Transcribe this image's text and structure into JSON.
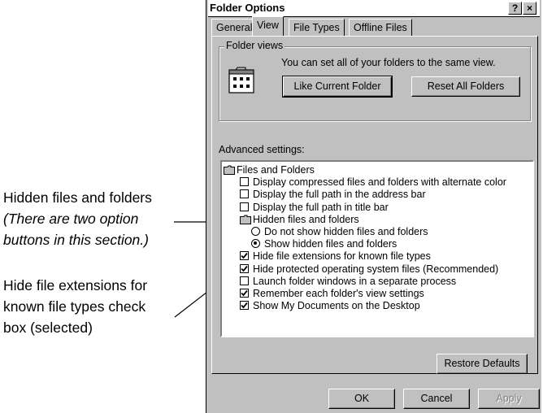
{
  "callouts": {
    "hidden": {
      "title": "Hidden files and folders",
      "note": "(There are two option buttons in this section.)"
    },
    "hide_ext": {
      "line1": "Hide file extensions for",
      "line2": "known file types check",
      "line3": "box (selected)"
    }
  },
  "dialog": {
    "title": "Folder Options",
    "help_button": "?",
    "close_button": "×",
    "tabs": [
      {
        "label": "General",
        "active": false
      },
      {
        "label": "View",
        "active": true
      },
      {
        "label": "File Types",
        "active": false
      },
      {
        "label": "Offline Files",
        "active": false
      }
    ],
    "folder_views": {
      "label": "Folder views",
      "description": "You can set all of your folders to the same view.",
      "like_current": "Like Current Folder",
      "reset_all": "Reset All Folders"
    },
    "advanced_label": "Advanced settings:",
    "settings": [
      {
        "kind": "folder",
        "label": "Files and Folders"
      },
      {
        "kind": "checkbox",
        "checked": false,
        "label": "Display compressed files and folders with alternate color"
      },
      {
        "kind": "checkbox",
        "checked": false,
        "label": "Display the full path in the address bar"
      },
      {
        "kind": "checkbox",
        "checked": false,
        "label": "Display the full path in title bar"
      },
      {
        "kind": "folder",
        "label": "Hidden files and folders"
      },
      {
        "kind": "radio",
        "checked": false,
        "label": "Do not show hidden files and folders"
      },
      {
        "kind": "radio",
        "checked": true,
        "label": "Show hidden files and folders"
      },
      {
        "kind": "checkbox",
        "checked": true,
        "label": "Hide file extensions for known file types"
      },
      {
        "kind": "checkbox",
        "checked": true,
        "label": "Hide protected operating system files (Recommended)"
      },
      {
        "kind": "checkbox",
        "checked": false,
        "label": "Launch folder windows in a separate process"
      },
      {
        "kind": "checkbox",
        "checked": true,
        "label": "Remember each folder's view settings"
      },
      {
        "kind": "checkbox",
        "checked": true,
        "label": "Show My Documents on the Desktop"
      }
    ],
    "restore_defaults": "Restore Defaults",
    "ok": "OK",
    "cancel": "Cancel",
    "apply": "Apply",
    "apply_enabled": false
  },
  "colors": {
    "face": "#c0c0c0",
    "shadow": "#808080",
    "highlight": "#ffffff"
  }
}
